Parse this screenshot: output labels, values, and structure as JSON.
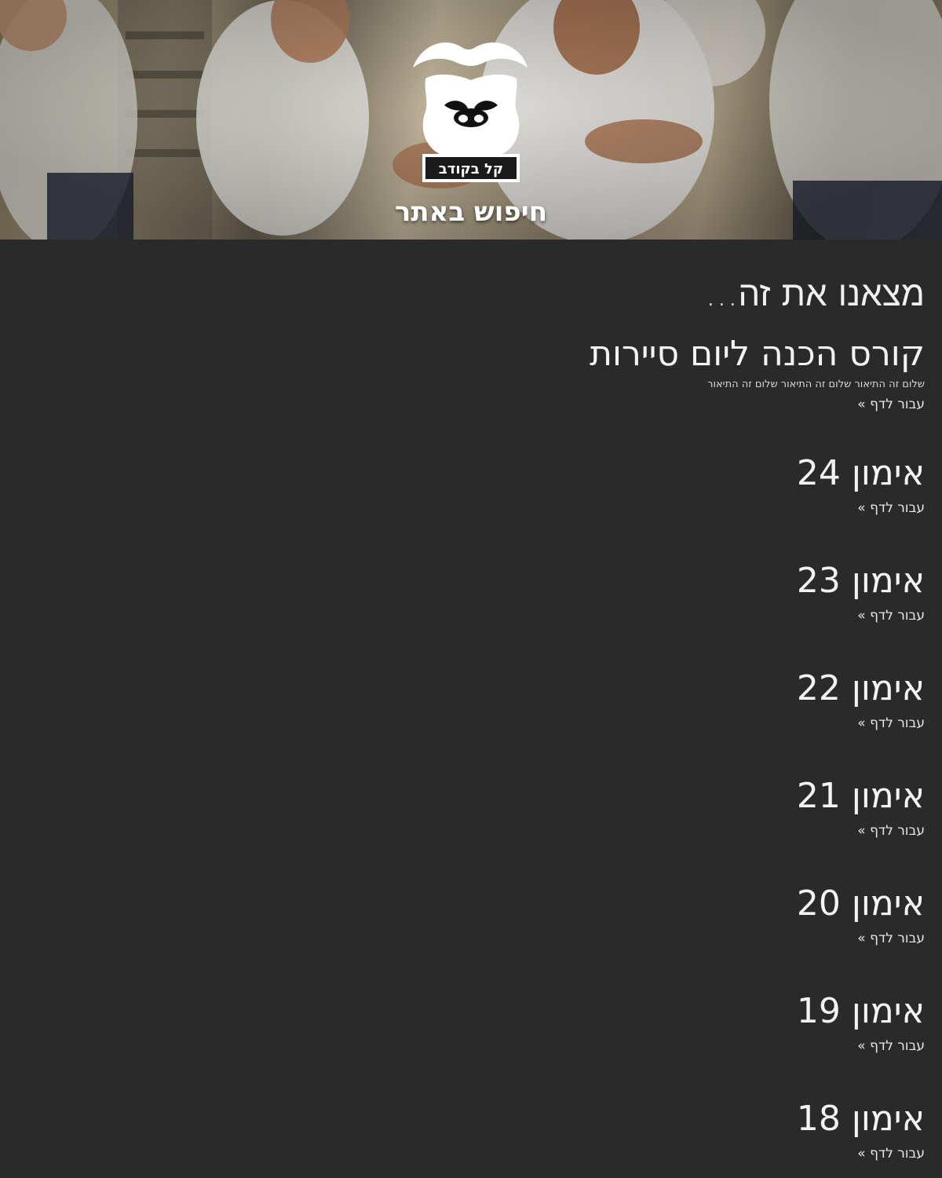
{
  "hero": {
    "logo_text": "קל בקודב",
    "title": "חיפוש באתר"
  },
  "search": {
    "heading": "מצאנו את זה..."
  },
  "results": [
    {
      "title": "קורס הכנה ליום סיירות",
      "description": "שלום זה התיאור שלום זה התיאור שלום זה התיאור",
      "link": "עבור לדף »"
    },
    {
      "title": "אימון 24",
      "link": "עבור לדף »"
    },
    {
      "title": "אימון 23",
      "link": "עבור לדף »"
    },
    {
      "title": "אימון 22",
      "link": "עבור לדף »"
    },
    {
      "title": "אימון 21",
      "link": "עבור לדף »"
    },
    {
      "title": "אימון 20",
      "link": "עבור לדף »"
    },
    {
      "title": "אימון 19",
      "link": "עבור לדף »"
    },
    {
      "title": "אימון 18",
      "link": "עבור לדף »"
    }
  ]
}
